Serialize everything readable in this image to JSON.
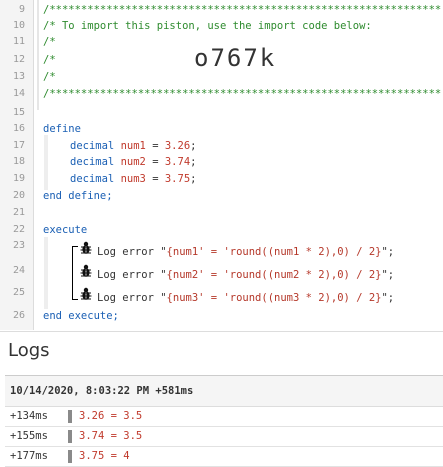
{
  "editor": {
    "line_numbers": [
      "9",
      "10",
      "11",
      "12",
      "13",
      "14",
      "15",
      "16",
      "17",
      "18",
      "19",
      "20",
      "21",
      "22",
      "23",
      "24",
      "25",
      "26"
    ],
    "stars_line": "/**************************************************************",
    "import_comment": "/* To import this piston, use the import code below:",
    "comment_open": "/*",
    "import_code": "o767k",
    "define_kw": "define",
    "decl": [
      {
        "type": "decimal",
        "var": "num1",
        "eq": " = ",
        "value": "3.26",
        "semi": ";"
      },
      {
        "type": "decimal",
        "var": "num2",
        "eq": " = ",
        "value": "3.74",
        "semi": ";"
      },
      {
        "type": "decimal",
        "var": "num3",
        "eq": " = ",
        "value": "3.75",
        "semi": ";"
      }
    ],
    "end_define": "end define;",
    "execute_kw": "execute",
    "log_stmts": [
      {
        "prefix": "Log error \"",
        "expr": "{num1' = 'round((num1 * 2),0) / 2}",
        "suffix": "\";"
      },
      {
        "prefix": "Log error \"",
        "expr": "{num2' = 'round((num2 * 2),0) / 2}",
        "suffix": "\";"
      },
      {
        "prefix": "Log error \"",
        "expr": "{num3' = 'round((num3 * 2),0) / 2}",
        "suffix": "\";"
      }
    ],
    "end_execute": "end execute;",
    "icons": [
      "bug-icon",
      "bug-icon",
      "bug-icon"
    ]
  },
  "logs": {
    "title": "Logs",
    "header": "10/14/2020, 8:03:22 PM +581ms",
    "entries": [
      {
        "time": "+134ms",
        "message": "3.26 = 3.5"
      },
      {
        "time": "+155ms",
        "message": "3.74 = 3.5"
      },
      {
        "time": "+177ms",
        "message": "3.75 = 4"
      }
    ],
    "error_color": "#c0392b"
  }
}
